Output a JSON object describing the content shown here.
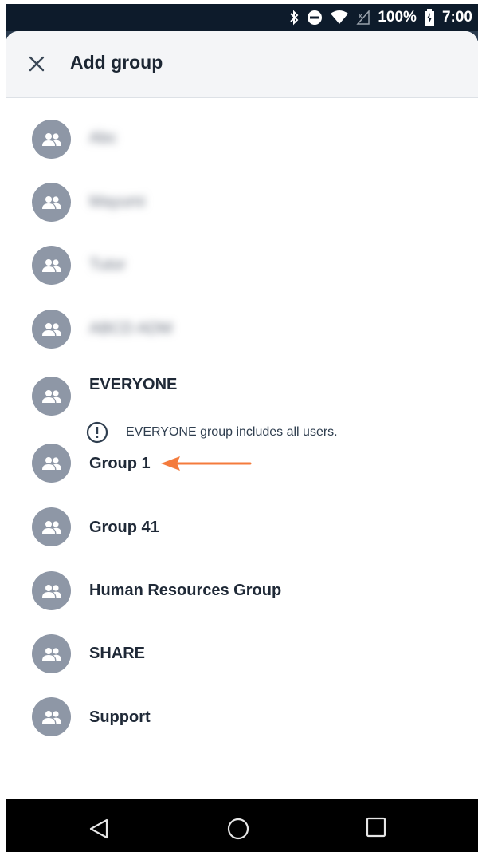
{
  "status_bar": {
    "icons": [
      "bluetooth-icon",
      "do-not-disturb-icon",
      "wifi-icon",
      "cell-signal-icon",
      "battery-charging-icon"
    ],
    "battery": "100%",
    "time": "7:00"
  },
  "header": {
    "title": "Add group",
    "close_icon": "close-icon"
  },
  "groups": [
    {
      "label": "Abc",
      "blurred": true
    },
    {
      "label": "Mayumi",
      "blurred": true
    },
    {
      "label": "Tutor",
      "blurred": true
    },
    {
      "label": "ABCD ADM",
      "blurred": true
    },
    {
      "label": "EVERYONE",
      "blurred": false
    },
    {
      "label": "Group 1",
      "blurred": false
    },
    {
      "label": "Group 41",
      "blurred": false
    },
    {
      "label": "Human Resources Group",
      "blurred": false
    },
    {
      "label": "SHARE",
      "blurred": false
    },
    {
      "label": "Support",
      "blurred": false
    }
  ],
  "everyone_notice": {
    "icon": "info-circle-icon",
    "text": "EVERYONE group includes all users."
  },
  "annotation": {
    "icon": "arrow-left-icon",
    "color": "#f47b3c"
  },
  "nav_bar": {
    "back_icon": "back-triangle-icon",
    "home_icon": "home-circle-icon",
    "recents_icon": "recents-square-icon"
  }
}
